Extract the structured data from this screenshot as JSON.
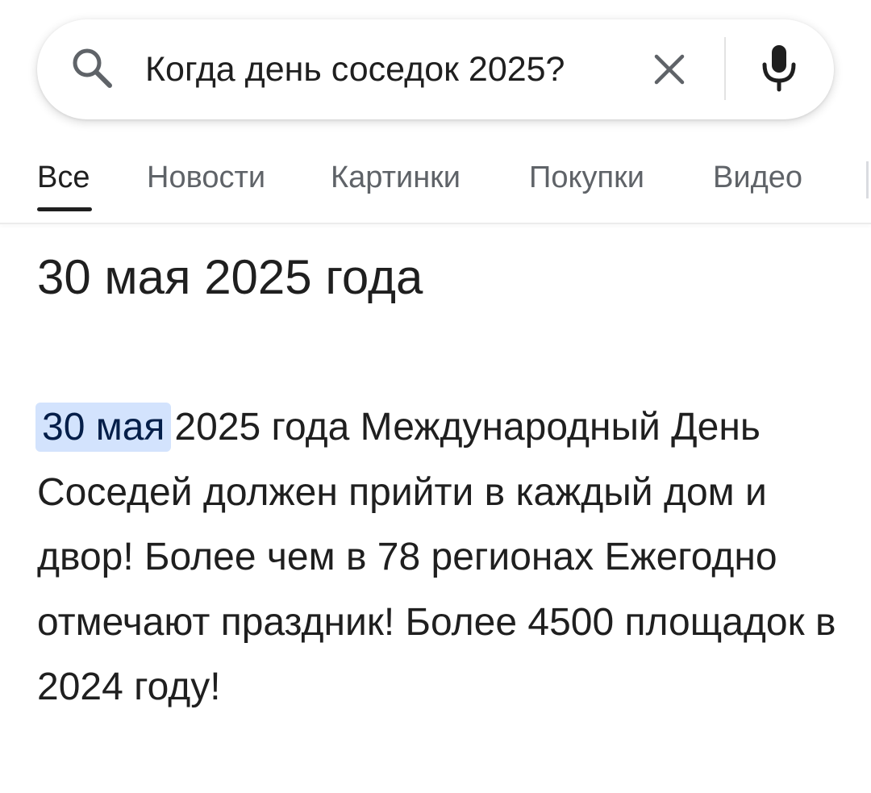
{
  "search": {
    "query": "Когда день соседок 2025?"
  },
  "tabs": [
    {
      "label": "Все",
      "active": true
    },
    {
      "label": "Новости",
      "active": false
    },
    {
      "label": "Картинки",
      "active": false
    },
    {
      "label": "Покупки",
      "active": false
    },
    {
      "label": "Видео",
      "active": false
    }
  ],
  "answer": {
    "title": "30 мая 2025 года",
    "highlight": "30 мая",
    "snippet": "2025 года Международный День Соседей должен прийти в каждый дом и двор! Более чем в 78 регионах Ежегодно отмечают праздник! Более 4500 площадок в 2024 году!"
  },
  "icons": {
    "search": "search-icon",
    "clear": "close-icon",
    "mic": "microphone-icon"
  },
  "colors": {
    "highlight_bg": "#d3e3fd",
    "tab_inactive": "#5f6368",
    "text": "#1f1f1f"
  }
}
